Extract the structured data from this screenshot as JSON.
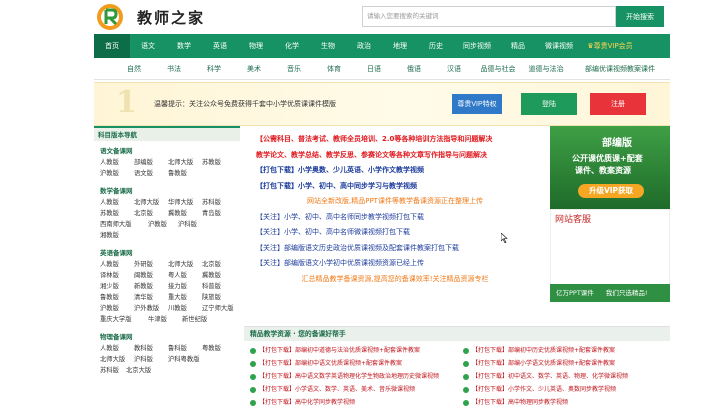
{
  "header": {
    "site_name": "教师之家",
    "search_placeholder": "请输入您要搜索的关键词",
    "search_button": "开始搜索"
  },
  "nav_main": [
    "首页",
    "语文",
    "数学",
    "英语",
    "物理",
    "化学",
    "生物",
    "政治",
    "地理",
    "历史",
    "同步视频",
    "精品",
    "微课视频"
  ],
  "nav_vip": "尊贵VIP会员",
  "nav_sub": [
    "自然",
    "书法",
    "科学",
    "美术",
    "音乐",
    "体育",
    "日语",
    "俄语",
    "汉语",
    "品德与社会",
    "道德与法治",
    "部编优课视频教案课件"
  ],
  "banner": {
    "deco": "1",
    "notice": "温馨提示：关注公众号免费获得千套中小学优质课课件模版",
    "vip_button": "尊贵VIP特权",
    "login_button": "登陆",
    "register_button": "注册"
  },
  "sidebar": {
    "title": "科目版本导航",
    "sections": [
      {
        "title": "语文备课网",
        "items": [
          "人教版",
          "部编版",
          "北师大版",
          "苏教版",
          "沪教版",
          "语文版",
          "鲁教版"
        ]
      },
      {
        "title": "数学备课网",
        "items": [
          "人教版",
          "北师大版",
          "华师大版",
          "苏科版",
          "苏教版",
          "北京版",
          "冀教版",
          "青岛版",
          "西南师大版",
          "沪教版",
          "沪科版",
          "湘教版"
        ]
      },
      {
        "title": "英语备课网",
        "items": [
          "人教版",
          "外研版",
          "北师大版",
          "北京版",
          "译林版",
          "闽教版",
          "粤人版",
          "冀教版",
          "湘少版",
          "新教版",
          "接力版",
          "科普版",
          "鲁教版",
          "清华版",
          "重大版",
          "陕旅版",
          "沪教版",
          "沪外教版",
          "川教版",
          "辽宁师大版",
          "重庆大学版",
          "牛津版",
          "新世纪版"
        ]
      },
      {
        "title": "物理备课网",
        "items": [
          "人教版",
          "教科版",
          "鲁科版",
          "粤教版",
          "北师大版",
          "沪科版",
          "沪科粤教版",
          "苏科版",
          "北京大版"
        ]
      }
    ]
  },
  "middle_lines": [
    {
      "text": "【公需科目、普法考试、教师全员培训、2.0等各种培训方法指导和问题解决",
      "style": "red"
    },
    {
      "text": "教学论文、教学总结、教学反思、参赛论文等各种文章写作指导与问题解决",
      "style": "red"
    },
    {
      "text": "【打包下载】小学奥数、少儿英语、小学作文教学视频",
      "style": "bluebold"
    },
    {
      "text": "【打包下载】小学、初中、高中同步学习与教学视频",
      "style": "bluebold"
    },
    {
      "text": "网站全新改版,精品PPT课件等教学备课资源正在整理上传",
      "style": "orange"
    },
    {
      "text": "【关注】小学、初中、高中名师同步教学视频打包下载",
      "style": "blue"
    },
    {
      "text": "【关注】小学、初中、高中名师微课视频打包下载",
      "style": "blue"
    },
    {
      "text": "【关注】部编版语文历史政治优质课视频及配套课件教案打包下载",
      "style": "blue"
    },
    {
      "text": "【关注】部编版语文小学初中优质课视频资源已经上传",
      "style": "blue"
    },
    {
      "text": "汇总精品教学备课资源,提高您的备课效率!关注精品资源专栏",
      "style": "orange"
    }
  ],
  "ad": {
    "title": "部编版",
    "line1": "公开课优质课+配套",
    "line2": "课件、教案资源",
    "button": "升级VIP获取"
  },
  "service": {
    "title": "网站客服"
  },
  "promo": {
    "left": "亿万PPT课件",
    "right": "我们只选精品!"
  },
  "resources": {
    "title": "精品教学资源 · 您的备课好帮手",
    "items": [
      "【打包下载】部编初中道德与法治优质课视频+配套课件教案",
      "【打包下载】部编初中历史优质课视频+配套课件教案",
      "【打包下载】部编初中语文优质课视频+配套课件教案",
      "【打包下载】部编小学语文优质课视频+配套课件教案",
      "【打包下载】高中语文数学英语物理化学生物政治地理历史微课视频",
      "【打包下载】初中语文、数学、英语、物理、化学微课视频",
      "【打包下载】小学语文、数学、英语、美术、音乐微课视频",
      "【打包下载】小学作文、少儿英语、奥数同步教学视频",
      "【打包下载】高中化学同步教学视频",
      "【打包下载】高中物理同步教学视频"
    ]
  },
  "colors": {
    "primary": "#179265",
    "red": "#e0191e",
    "blue": "#1c3c9c",
    "orange": "#f07a18"
  }
}
